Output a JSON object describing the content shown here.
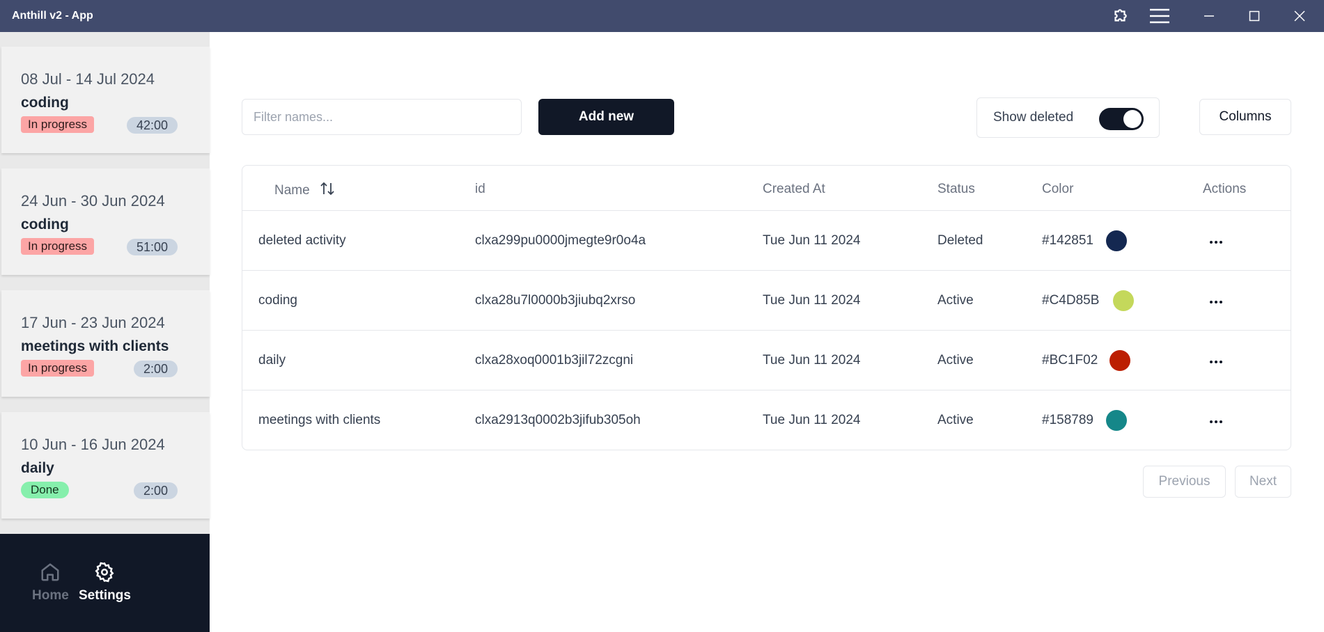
{
  "window": {
    "title": "Anthill v2 - App"
  },
  "icons": {
    "puzzle": "puzzle-icon",
    "menu": "hamburger-menu-icon",
    "minimize": "minimize-icon",
    "maximize": "maximize-icon",
    "close": "close-icon",
    "home": "home-icon",
    "settings": "gear-icon",
    "sort": "sort-arrows-icon",
    "more": "ellipsis-icon"
  },
  "sidebar": {
    "weeks": [
      {
        "dates": "08 Jul - 14 Jul 2024",
        "activity": "coding",
        "status": "In progress",
        "time": "42:00"
      },
      {
        "dates": "24 Jun - 30 Jun 2024",
        "activity": "coding",
        "status": "In progress",
        "time": "51:00"
      },
      {
        "dates": "17 Jun - 23 Jun 2024",
        "activity": "meetings with clients",
        "status": "In progress",
        "time": "2:00"
      },
      {
        "dates": "10 Jun - 16 Jun 2024",
        "activity": "daily",
        "status": "Done",
        "time": "2:00"
      }
    ],
    "nav": {
      "home": "Home",
      "settings": "Settings"
    }
  },
  "toolbar": {
    "filter_placeholder": "Filter names...",
    "filter_value": "",
    "add_label": "Add new",
    "show_deleted_label": "Show deleted",
    "show_deleted_on": true,
    "columns_label": "Columns"
  },
  "table": {
    "headers": {
      "name": "Name",
      "id": "id",
      "created": "Created At",
      "status": "Status",
      "color": "Color",
      "actions": "Actions"
    },
    "rows": [
      {
        "name": "deleted activity",
        "id": "clxa299pu0000jmegte9r0o4a",
        "created": "Tue Jun 11 2024",
        "status": "Deleted",
        "color": "#142851"
      },
      {
        "name": "coding",
        "id": "clxa28u7l0000b3jiubq2xrso",
        "created": "Tue Jun 11 2024",
        "status": "Active",
        "color": "#C4D85B"
      },
      {
        "name": "daily",
        "id": "clxa28xoq0001b3jil72zcgni",
        "created": "Tue Jun 11 2024",
        "status": "Active",
        "color": "#BC1F02"
      },
      {
        "name": "meetings with clients",
        "id": "clxa2913q0002b3jifub305oh",
        "created": "Tue Jun 11 2024",
        "status": "Active",
        "color": "#158789"
      }
    ]
  },
  "pagination": {
    "previous": "Previous",
    "next": "Next"
  },
  "colors": {
    "titlebar": "#414b6d",
    "dark": "#111827",
    "in_progress": "#fca5a5",
    "done": "#86efac",
    "time_badge": "#cbd5e1"
  }
}
